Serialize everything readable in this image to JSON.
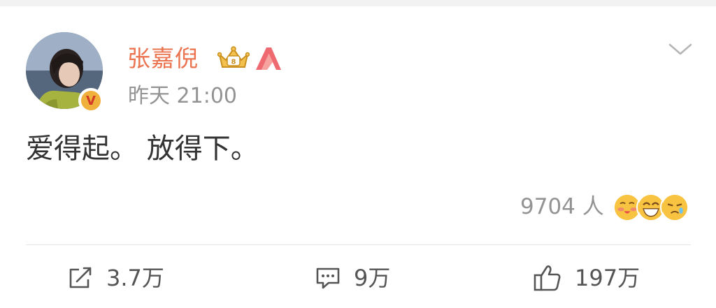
{
  "post": {
    "author": {
      "name": "张嘉倪",
      "verified_badge": "V"
    },
    "timestamp": "昨天 21:00",
    "text": "爱得起。 放得下。",
    "reactions": {
      "count_label": "9704 人"
    }
  },
  "actions": {
    "repost_count": "3.7万",
    "comment_count": "9万",
    "like_count": "197万"
  },
  "colors": {
    "username": "#eb7350",
    "meta": "#939393",
    "text": "#333333",
    "badge_bg": "#f0b03c",
    "badge_fg": "#d23b26"
  },
  "icons": [
    "crown-badge-icon",
    "a-badge-icon",
    "chevron-down-icon",
    "repost-icon",
    "comment-icon",
    "thumbs-up-icon"
  ]
}
